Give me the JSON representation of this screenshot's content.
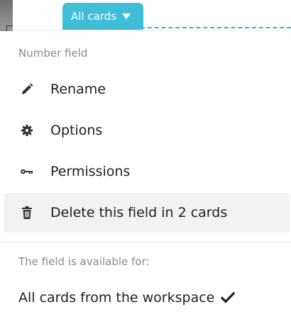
{
  "tag_button": {
    "label": "All cards"
  },
  "menu": {
    "section_title": "Number field",
    "items": [
      {
        "icon": "pencil-icon",
        "label": "Rename"
      },
      {
        "icon": "gear-icon",
        "label": "Options"
      },
      {
        "icon": "key-icon",
        "label": "Permissions"
      },
      {
        "icon": "trash-icon",
        "label": "Delete this field in 2 cards"
      }
    ],
    "availability_title": "The field is available for:",
    "availability_option": "All cards from the workspace"
  },
  "colors": {
    "accent": "#40bed8",
    "dashed_line": "#34b4cf",
    "hover_bg": "#f2f2f2",
    "muted_text": "#8b8b8b",
    "text": "#1f1f1f"
  }
}
